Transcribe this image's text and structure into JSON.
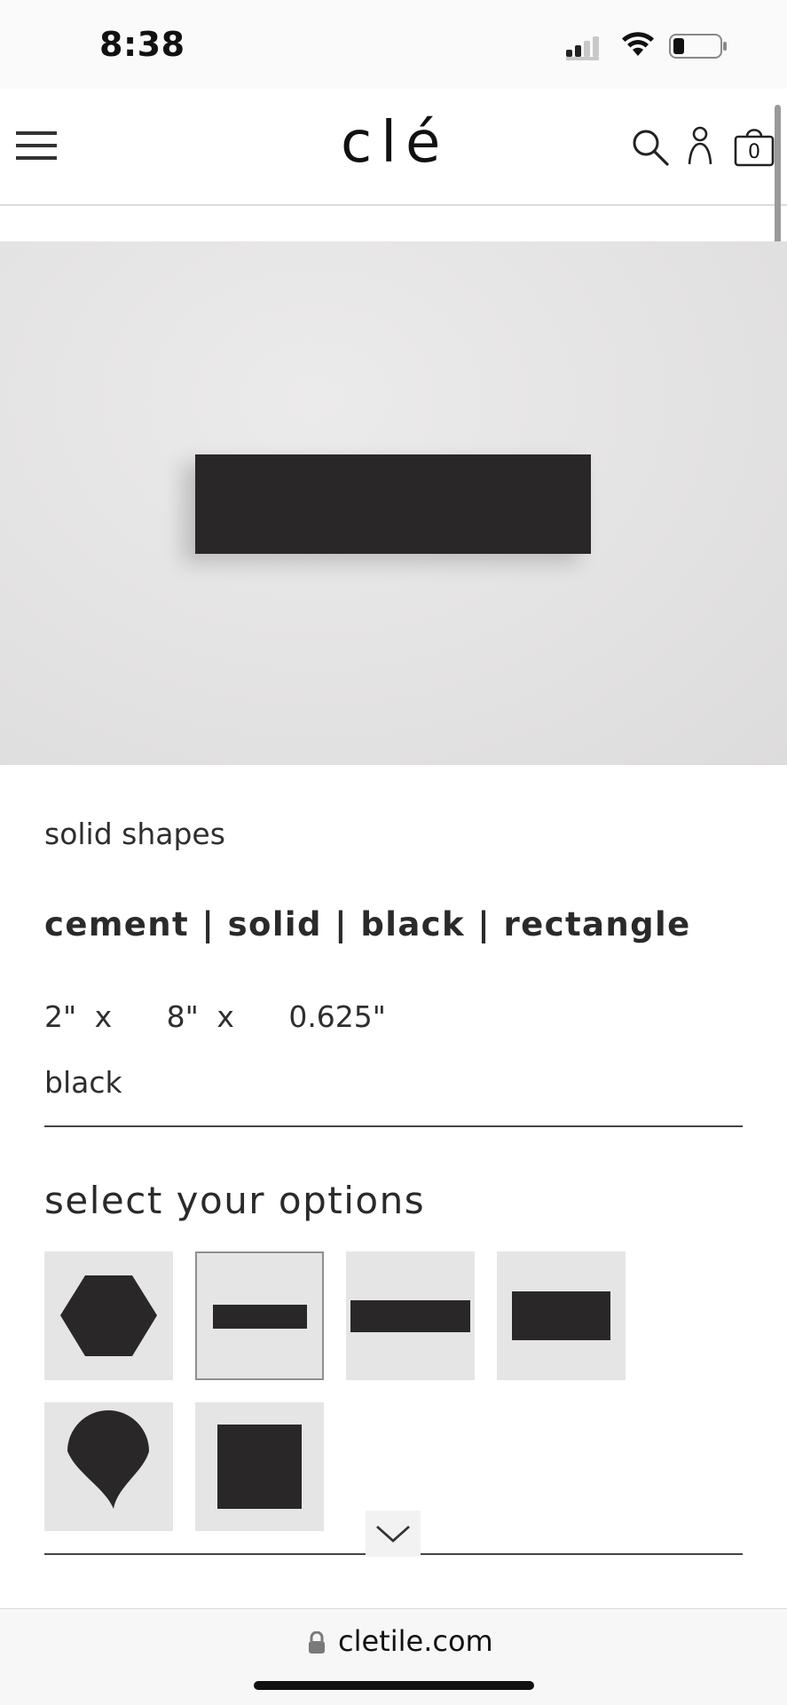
{
  "status_bar": {
    "time": "8:38"
  },
  "header": {
    "logo": "clé",
    "cart_count": "0"
  },
  "product": {
    "collection": "solid shapes",
    "title": "cement | solid | black | rectangle",
    "dimensions": "2\" x   8\" x   0.625\"",
    "color": "black"
  },
  "options": {
    "heading": "select your options",
    "items": [
      {
        "shape": "hexagon",
        "selected": false
      },
      {
        "shape": "rectangle-2x8",
        "selected": true
      },
      {
        "shape": "rectangle-3x12",
        "selected": false
      },
      {
        "shape": "rectangle-4x8",
        "selected": false
      },
      {
        "shape": "fan",
        "selected": false
      },
      {
        "shape": "square",
        "selected": false
      }
    ]
  },
  "browser": {
    "url": "cletile.com"
  },
  "colors": {
    "tile": "#2a2729",
    "background": "#e6e5e5",
    "text": "#2b2b2b"
  },
  "icons": [
    "menu-icon",
    "search-icon",
    "account-icon",
    "cart-icon",
    "chevron-down-icon",
    "lock-icon"
  ]
}
